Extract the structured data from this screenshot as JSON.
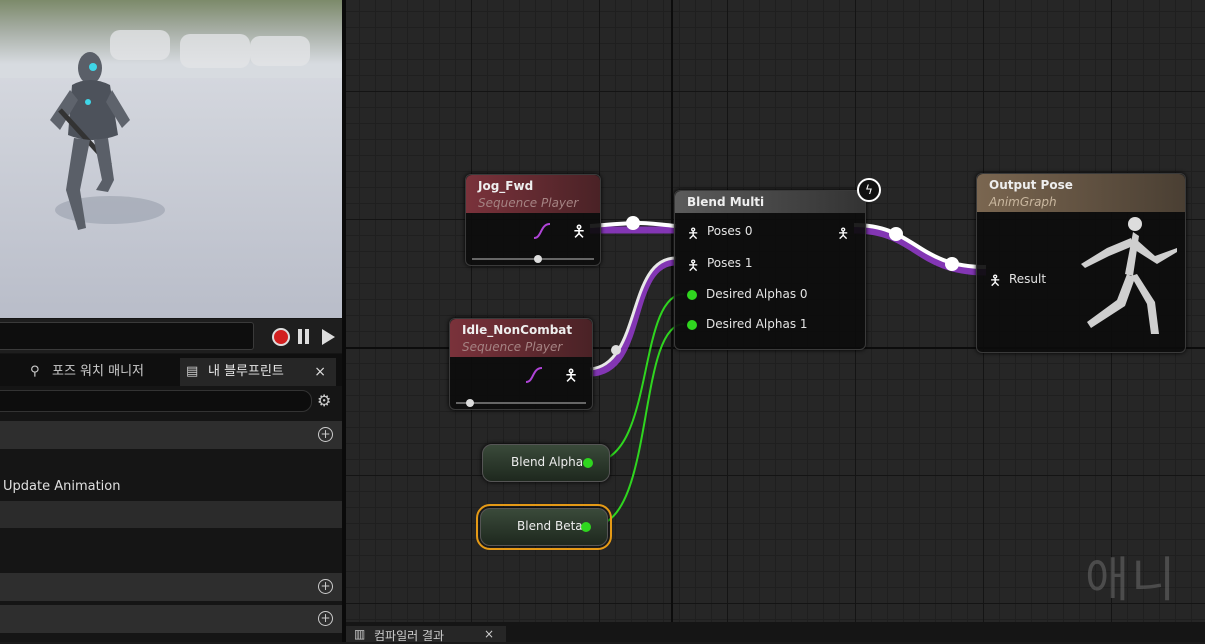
{
  "left_panel": {
    "tabs": [
      {
        "label": "포즈 워치 매니저",
        "icon": "pose-watch-icon"
      },
      {
        "label": "내 블루프린트",
        "icon": "blueprint-book-icon",
        "close": "×"
      }
    ],
    "search_placeholder": "",
    "row_label": "Update Animation"
  },
  "graph": {
    "nodes": {
      "jog_fwd": {
        "title": "Jog_Fwd",
        "subtitle": "Sequence Player"
      },
      "idle": {
        "title": "Idle_NonCombat",
        "subtitle": "Sequence Player"
      },
      "blend_multi": {
        "title": "Blend Multi",
        "pins": [
          "Poses 0",
          "Poses 1",
          "Desired Alphas 0",
          "Desired Alphas 1"
        ]
      },
      "output_pose": {
        "title": "Output Pose",
        "subtitle": "AnimGraph",
        "pin": "Result"
      },
      "blend_alpha": {
        "label": "Blend Alpha"
      },
      "blend_beta": {
        "label": "Blend Beta"
      }
    },
    "watermark": "애니"
  },
  "bottom_panel": {
    "tab_label": "컴파일러 결과",
    "close": "×"
  },
  "colors": {
    "pose_wire": "#ffffff",
    "pose_wire_glow": "#9b3bd8",
    "float_wire": "#2fd61f",
    "selected_outline": "#e59a16",
    "sequence_header": "#6d2c34",
    "output_header": "#6b5a45"
  }
}
